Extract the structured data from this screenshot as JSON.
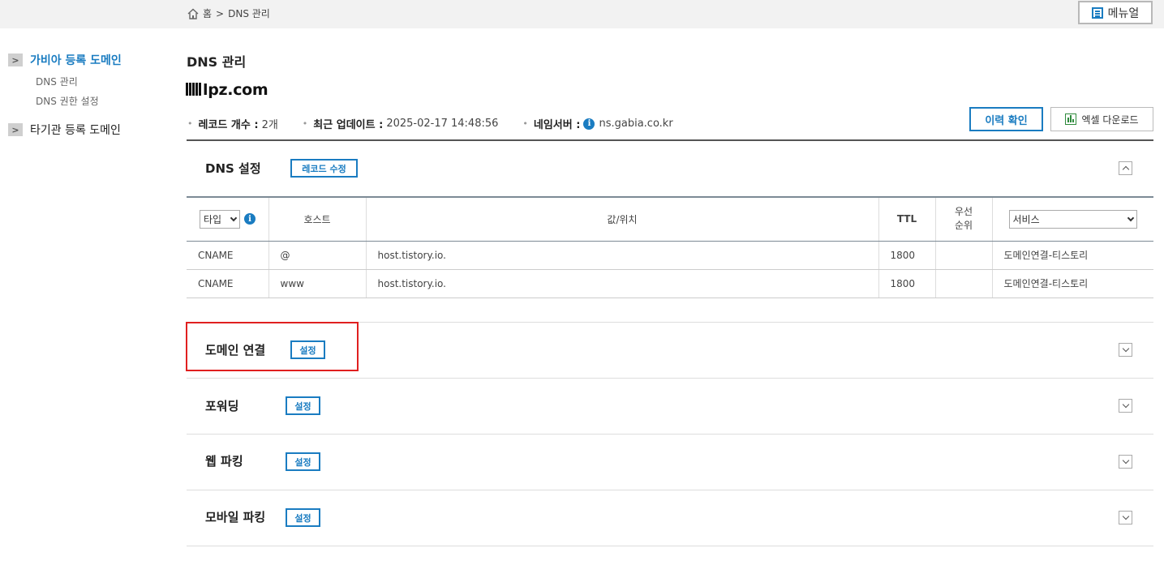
{
  "breadcrumb": {
    "home": "홈",
    "separator": ">",
    "current": "DNS 관리",
    "home_icon": "home-icon"
  },
  "header": {
    "manual_label": "메뉴얼",
    "manual_icon": "list-icon"
  },
  "sidebar": {
    "groups": [
      {
        "label": "가비아 등록 도메인",
        "sub": [
          "DNS 관리",
          "DNS 권한 설정"
        ]
      },
      {
        "label": "타기관 등록 도메인"
      }
    ]
  },
  "page": {
    "title": "DNS 관리",
    "domain": "lpz.com",
    "record_count_label": "레코드 개수 :",
    "record_count_value": "2개",
    "updated_label": "최근 업데이트 :",
    "updated_value": "2025-02-17 14:48:56",
    "nameserver_label": "네임서버 :",
    "nameserver_value": "ns.gabia.co.kr",
    "history_btn": "이력 확인",
    "excel_btn": "엑셀 다운로드"
  },
  "dns_section": {
    "title": "DNS 설정",
    "edit_btn": "레코드 수정",
    "columns": {
      "type": "타입",
      "host": "호스트",
      "value": "값/위치",
      "ttl": "TTL",
      "priority_line1": "우선",
      "priority_line2": "순위",
      "service": "서비스"
    },
    "rows": [
      {
        "type": "CNAME",
        "host": "@",
        "value": "host.tistory.io.",
        "ttl": "1800",
        "priority": "",
        "service": "도메인연결-티스토리"
      },
      {
        "type": "CNAME",
        "host": "www",
        "value": "host.tistory.io.",
        "ttl": "1800",
        "priority": "",
        "service": "도메인연결-티스토리"
      }
    ]
  },
  "sections": [
    {
      "title": "도메인 연결",
      "btn": "설정"
    },
    {
      "title": "포워딩",
      "btn": "설정"
    },
    {
      "title": "웹 파킹",
      "btn": "설정"
    },
    {
      "title": "모바일 파킹",
      "btn": "설정"
    }
  ],
  "colors": {
    "accent": "#1a7cc1",
    "highlight": "#e02020"
  }
}
